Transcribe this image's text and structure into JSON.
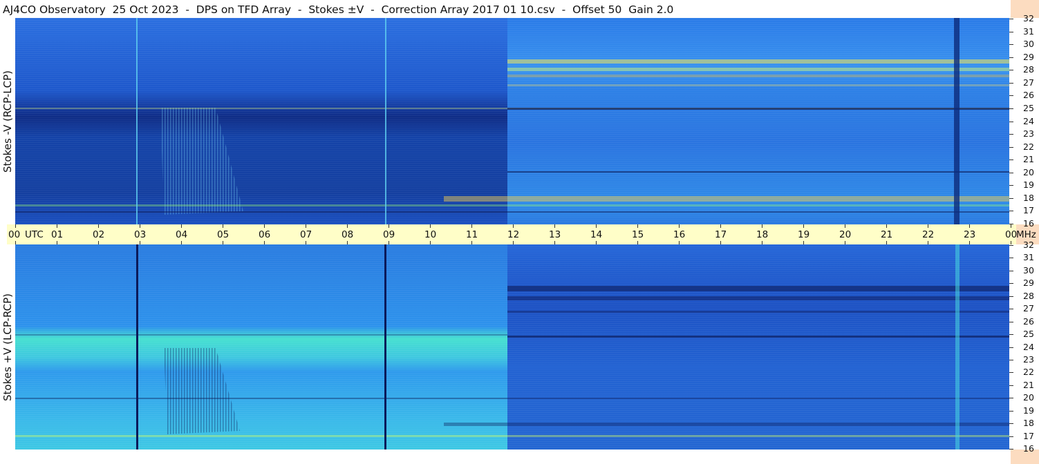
{
  "header": {
    "title": "AJ4CO Observatory  25 Oct 2023  -  DPS on TFD Array  -  Stokes ±V  -  Correction Array 2017 01 10.csv  -  Offset 50  Gain 2.0"
  },
  "panels": {
    "top_label": "Stokes -V (RCP-LCP)",
    "bottom_label": "Stokes +V (LCP-RCP)"
  },
  "time_axis": {
    "labels": [
      "00",
      "01",
      "02",
      "03",
      "04",
      "05",
      "06",
      "07",
      "08",
      "09",
      "10",
      "11",
      "12",
      "13",
      "14",
      "15",
      "16",
      "17",
      "18",
      "19",
      "20",
      "21",
      "22",
      "23",
      "00"
    ],
    "utc_label": "UTC",
    "mhz_label": "MHz"
  },
  "freq_axis": {
    "labels": [
      "32",
      "31",
      "30",
      "29",
      "28",
      "27",
      "26",
      "25",
      "24",
      "23",
      "22",
      "21",
      "20",
      "19",
      "18",
      "17",
      "16"
    ]
  },
  "colors": {
    "top_base": "#1f5fd6",
    "top_dark_band": "#0f2f8a",
    "bottom_base": "#2a8ae8",
    "bottom_bright_band": "#4ae0d0",
    "axis_bg": "#fffec8",
    "right_margin": "#fcdcc0"
  }
}
